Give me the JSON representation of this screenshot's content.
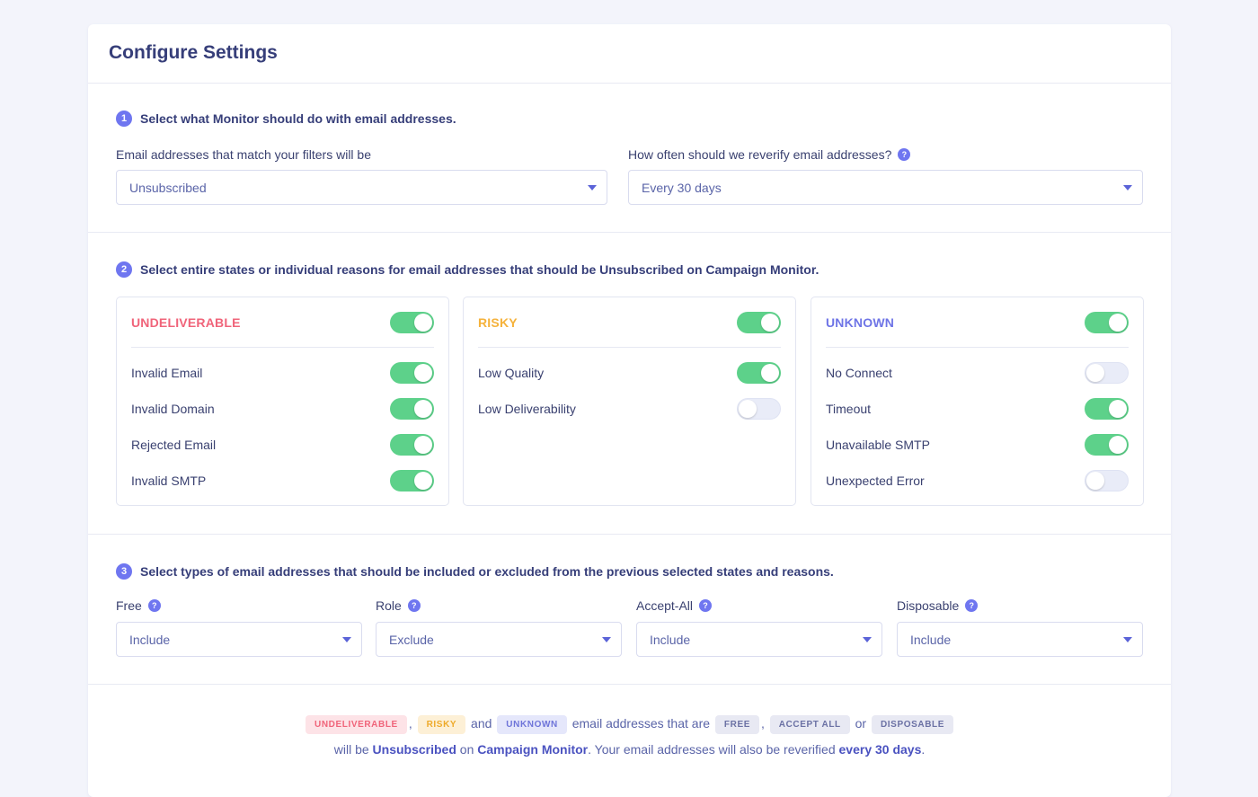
{
  "title": "Configure Settings",
  "section1": {
    "step": "1",
    "heading": "Select what Monitor should do with email addresses.",
    "action_label": "Email addresses that match your filters will be",
    "action_value": "Unsubscribed",
    "reverify_label": "How often should we reverify email addresses?",
    "reverify_value": "Every 30 days"
  },
  "section2": {
    "step": "2",
    "heading": "Select entire states or individual reasons for email addresses that should be Unsubscribed on Campaign Monitor.",
    "panels": [
      {
        "title": "UNDELIVERABLE",
        "color": "#f0647a",
        "enabled": true,
        "items": [
          {
            "label": "Invalid Email",
            "enabled": true
          },
          {
            "label": "Invalid Domain",
            "enabled": true
          },
          {
            "label": "Rejected Email",
            "enabled": true
          },
          {
            "label": "Invalid SMTP",
            "enabled": true
          }
        ]
      },
      {
        "title": "RISKY",
        "color": "#f5b23b",
        "enabled": true,
        "items": [
          {
            "label": "Low Quality",
            "enabled": true
          },
          {
            "label": "Low Deliverability",
            "enabled": false
          }
        ]
      },
      {
        "title": "UNKNOWN",
        "color": "#6e74e6",
        "enabled": true,
        "items": [
          {
            "label": "No Connect",
            "enabled": false
          },
          {
            "label": "Timeout",
            "enabled": true
          },
          {
            "label": "Unavailable SMTP",
            "enabled": true
          },
          {
            "label": "Unexpected Error",
            "enabled": false
          }
        ]
      }
    ]
  },
  "section3": {
    "step": "3",
    "heading": "Select types of email addresses that should be included or excluded from the previous selected states and reasons.",
    "filters": [
      {
        "label": "Free",
        "value": "Include"
      },
      {
        "label": "Role",
        "value": "Exclude"
      },
      {
        "label": "Accept-All",
        "value": "Include"
      },
      {
        "label": "Disposable",
        "value": "Include"
      }
    ]
  },
  "summary": {
    "chip_undeliverable": "UNDELIVERABLE",
    "comma1": ",",
    "chip_risky": "RISKY",
    "and": "and",
    "chip_unknown": "UNKNOWN",
    "middle_text": "email addresses that are",
    "chip_free": "FREE",
    "comma2": ",",
    "chip_accept_all": "ACCEPT ALL",
    "or": "or",
    "chip_disposable": "DISPOSABLE",
    "line2_a": "will be",
    "line2_action": "Unsubscribed",
    "line2_on": "on",
    "line2_service": "Campaign Monitor",
    "line2_b": ". Your email addresses will also be reverified",
    "line2_freq": "every 30 days",
    "line2_end": "."
  },
  "icons": {
    "help": "question-icon",
    "caret": "chevron-down-icon"
  },
  "colors": {
    "accent": "#6f76f0",
    "toggle_on": "#5dd18a",
    "toggle_off": "#e9ecf8"
  }
}
